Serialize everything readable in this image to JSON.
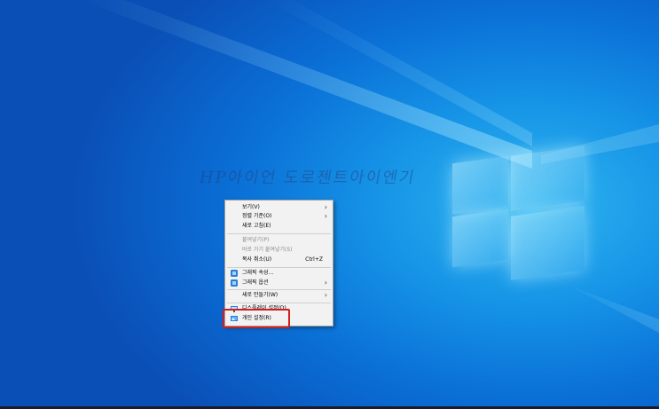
{
  "watermark": "HP아이언 도로젠트아이엔기",
  "context_menu": {
    "items": [
      {
        "label": "보기(V)",
        "arrow": "›"
      },
      {
        "label": "정렬 기준(O)",
        "arrow": "›"
      },
      {
        "label": "새로 고침(E)"
      },
      {
        "label": "붙여넣기(P)",
        "disabled": true
      },
      {
        "label": "바로 가기 붙여넣기(S)",
        "disabled": true
      },
      {
        "label": "복사 취소(U)",
        "shortcut": "Ctrl+Z"
      },
      {
        "label": "그래픽 속성...",
        "icon": "intel-graphics-icon"
      },
      {
        "label": "그래픽 옵션",
        "icon": "intel-graphics-icon",
        "arrow": "›"
      },
      {
        "label": "새로 만들기(W)",
        "arrow": "›"
      },
      {
        "label": "디스플레이 설정(D)",
        "icon": "display-settings-icon"
      },
      {
        "label": "개인 설정(R)",
        "icon": "personalize-icon"
      }
    ]
  },
  "colors": {
    "highlight": "#d11f1f",
    "icon_blue": "#2a7fd4"
  }
}
